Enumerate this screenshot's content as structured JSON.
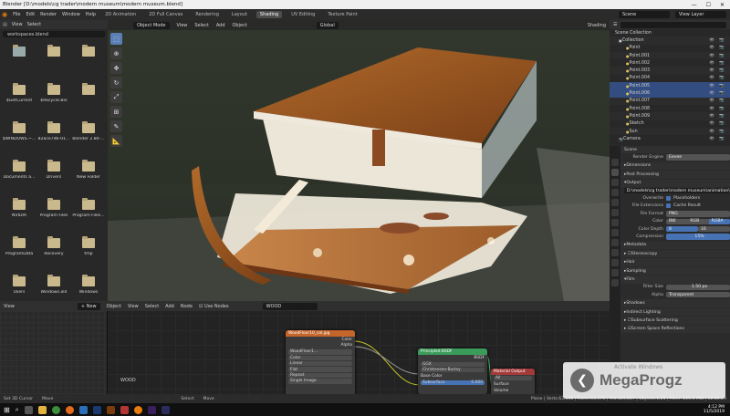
{
  "window": {
    "title": "Blender [D:\\models\\cg trader\\modern museum\\modern museum.blend]",
    "minimize": "—",
    "maximize": "☐",
    "close": "✕"
  },
  "topmenu": {
    "menus": [
      "File",
      "Edit",
      "Render",
      "Window",
      "Help"
    ],
    "workspaces": [
      "2D Animation",
      "2D Full Canvas",
      "Rendering",
      "Layout",
      "Shading",
      "UV Editing",
      "Texture Paint"
    ],
    "active_workspace": "Shading",
    "scene": "Scene",
    "view_layer": "View Layer"
  },
  "filebrowser": {
    "header": [
      "View",
      "Select"
    ],
    "path": "workspaces.blend",
    "items": [
      {
        "name": ""
      },
      {
        "name": ""
      },
      {
        "name": ""
      },
      {
        "name": "$GetCurrent"
      },
      {
        "name": "$Recycle.Bin"
      },
      {
        "name": ""
      },
      {
        "name": "$WINDOWS.~..."
      },
      {
        "name": "82ace7d6-01..."
      },
      {
        "name": "blender 2.80-..."
      },
      {
        "name": "Documents a..."
      },
      {
        "name": "Drivers"
      },
      {
        "name": "New Folder"
      },
      {
        "name": "NVIDIA"
      },
      {
        "name": "Program Files"
      },
      {
        "name": "Program Files..."
      },
      {
        "name": "ProgramData"
      },
      {
        "name": "Recovery"
      },
      {
        "name": "tmp"
      },
      {
        "name": "Users"
      },
      {
        "name": "Windows.old"
      },
      {
        "name": "Windows"
      },
      {
        "name": ""
      }
    ]
  },
  "viewport": {
    "mode": "Object Mode",
    "menus": [
      "View",
      "Select",
      "Add",
      "Object"
    ],
    "orientation": "Global",
    "shading": "Shading"
  },
  "outliner": {
    "title": "Scene Collection",
    "rows": [
      {
        "name": "Collection",
        "selected": false
      },
      {
        "name": "Point",
        "selected": false
      },
      {
        "name": "Point.001",
        "selected": false
      },
      {
        "name": "Point.002",
        "selected": false
      },
      {
        "name": "Point.003",
        "selected": false
      },
      {
        "name": "Point.004",
        "selected": false
      },
      {
        "name": "Point.005",
        "selected": true
      },
      {
        "name": "Point.006",
        "selected": true
      },
      {
        "name": "Point.007",
        "selected": false
      },
      {
        "name": "Point.008",
        "selected": false
      },
      {
        "name": "Point.009",
        "selected": false
      },
      {
        "name": "Sketch",
        "selected": false
      },
      {
        "name": "Sun",
        "selected": false
      },
      {
        "name": "Camera",
        "selected": false
      }
    ]
  },
  "properties": {
    "scene": "Scene",
    "render_engine_label": "Render Engine",
    "render_engine": "Eevee",
    "sections": {
      "dimensions": "Dimensions",
      "post_processing": "Post Processing",
      "output": "Output",
      "metadata": "Metadata",
      "stereoscopy": "Stereoscopy",
      "hair": "Hair",
      "sampling": "Sampling",
      "film": "Film",
      "shadows": "Shadows",
      "indirect": "Indirect Lighting",
      "sss": "Subsurface Scattering",
      "ssr": "Screen Space Reflections"
    },
    "output_path": "D:\\models\\cg trader\\modern museum\\animation\\",
    "overwrite": "Overwrite",
    "placeholders": "Placeholders",
    "file_extensions": "File Extensions",
    "cache_result": "Cache Result",
    "file_format_label": "File Format",
    "file_format": "PNG",
    "color_label": "Color",
    "color_options": [
      "BW",
      "RGB",
      "RGBA"
    ],
    "color_depth_label": "Color Depth",
    "color_depth_options": [
      "8",
      "16"
    ],
    "compression_label": "Compression",
    "compression": "15%",
    "filter_size_label": "Filter Size",
    "filter_size": "1.50 px",
    "alpha_label": "Alpha",
    "alpha": "Transparent"
  },
  "nodeeditor": {
    "editor_type": "Object",
    "menus": [
      "View",
      "Select",
      "Add",
      "Node"
    ],
    "use_nodes": "Use Nodes",
    "material": "WOOD",
    "new_button": "+ New",
    "canvas_label": "WOOD",
    "image_node": {
      "title": "WoodFloor10_col.jpg",
      "outputs": [
        "Color",
        "Alpha"
      ],
      "image": "WoodFloor1...",
      "fields": [
        "Color",
        "Linear",
        "Flat",
        "Repeat",
        "Single Image"
      ]
    },
    "bsdf_node": {
      "title": "Principled BSDF",
      "output": "BSDF",
      "fields": [
        "GGX",
        "Christensen-Burley",
        "Base Color",
        "Subsurface"
      ],
      "subsurface": "0.000"
    },
    "output_node": {
      "title": "Material Output",
      "option": "All",
      "inputs": [
        "Surface",
        "Volume"
      ]
    }
  },
  "statusbar": {
    "items": [
      "Set 3D Cursor",
      "Move",
      "Select",
      "Move"
    ],
    "stats": "Plane | Verts:63,638 | Faces:63,376 | Tris:125,857 | Objects:1/25 | Mem: 225.1 MiB | v2.80.29"
  },
  "taskbar": {
    "time": "4:12 PM",
    "date": "11/5/2019"
  },
  "watermark": {
    "text": "MegaProgz",
    "activate": "Activate Windows"
  }
}
